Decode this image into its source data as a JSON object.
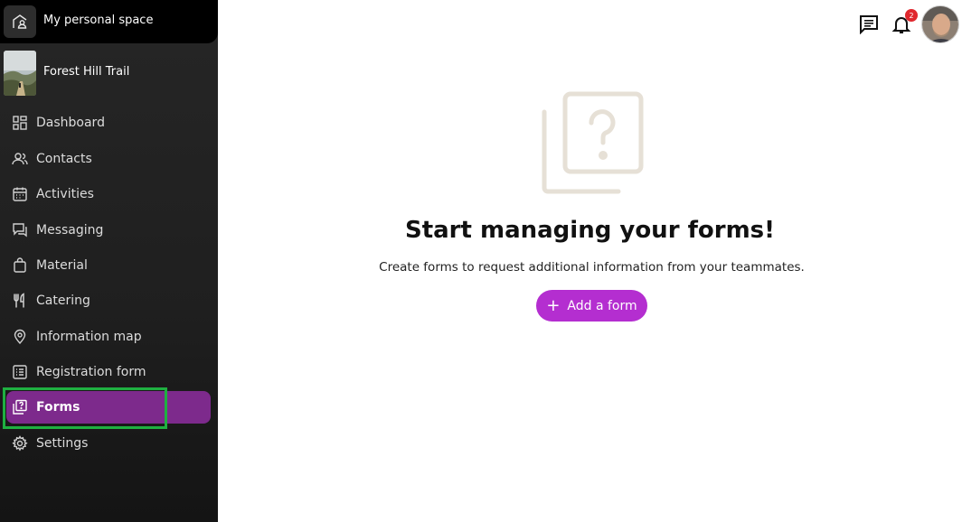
{
  "sidebar": {
    "space_label": "My personal space",
    "event_name": "Forest Hill Trail",
    "items": [
      {
        "label": "Dashboard",
        "icon": "dashboard-icon"
      },
      {
        "label": "Contacts",
        "icon": "contacts-icon"
      },
      {
        "label": "Activities",
        "icon": "calendar-icon"
      },
      {
        "label": "Messaging",
        "icon": "messaging-icon"
      },
      {
        "label": "Material",
        "icon": "bag-icon"
      },
      {
        "label": "Catering",
        "icon": "fork-knife-icon"
      },
      {
        "label": "Information map",
        "icon": "map-pin-icon"
      },
      {
        "label": "Registration form",
        "icon": "list-icon"
      },
      {
        "label": "Forms",
        "icon": "forms-icon",
        "active": true
      },
      {
        "label": "Settings",
        "icon": "gear-icon"
      }
    ]
  },
  "topbar": {
    "notification_count": "2",
    "message_icon": "chat-icon",
    "bell_icon": "bell-icon"
  },
  "main": {
    "empty_title": "Start managing your forms!",
    "empty_description": "Create forms to request additional information from your teammates.",
    "add_button_label": "Add a form"
  },
  "colors": {
    "accent": "#b42ed0",
    "active_nav": "#7d2a8c",
    "highlight": "#1fb041",
    "badge": "#e0282e"
  }
}
